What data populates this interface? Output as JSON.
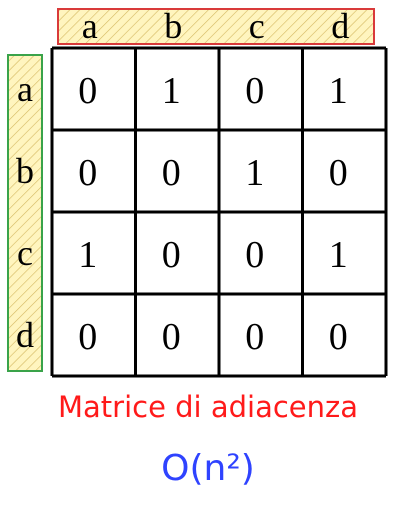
{
  "column_labels": [
    "a",
    "b",
    "c",
    "d"
  ],
  "row_labels": [
    "a",
    "b",
    "c",
    "d"
  ],
  "matrix": [
    [
      "0",
      "1",
      "0",
      "1"
    ],
    [
      "0",
      "0",
      "1",
      "0"
    ],
    [
      "1",
      "0",
      "0",
      "1"
    ],
    [
      "0",
      "0",
      "0",
      "0"
    ]
  ],
  "caption": "Matrice di adiacenza",
  "complexity": "O(n²)",
  "colors": {
    "column_header_border": "#d93a3a",
    "row_header_border": "#3aa34a",
    "header_fill": "#fff5bf",
    "hatch": "#d4b860",
    "grid": "#000000",
    "caption": "#ff1a1a",
    "complexity": "#2f43ff"
  }
}
